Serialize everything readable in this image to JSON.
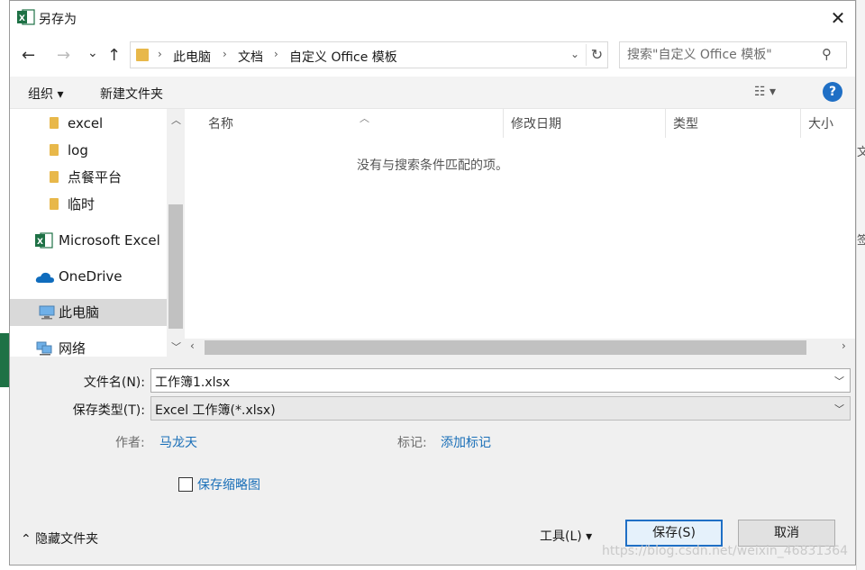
{
  "window": {
    "title": "另存为",
    "close_glyph": "✕"
  },
  "background": {
    "right_text_1": "文",
    "right_text_2": "签"
  },
  "nav": {
    "back_glyph": "←",
    "forward_glyph": "→",
    "recent_glyph": "⌄",
    "up_glyph": "↑",
    "breadcrumbs": [
      "此电脑",
      "文档",
      "自定义 Office 模板"
    ],
    "breadcrumb_sep": "›",
    "refresh_glyph": "↻",
    "dropdown_glyph": "⌄"
  },
  "search": {
    "placeholder": "搜索\"自定义 Office 模板\"",
    "icon": "search-icon"
  },
  "toolbar": {
    "organize_label": "组织 ▾",
    "new_folder_label": "新建文件夹",
    "view_glyph": "☷ ▾",
    "help_glyph": "?"
  },
  "sidebar": {
    "items": [
      {
        "label": "excel",
        "icon": "folder-icon"
      },
      {
        "label": "log",
        "icon": "folder-icon"
      },
      {
        "label": "点餐平台",
        "icon": "folder-icon"
      },
      {
        "label": "临时",
        "icon": "folder-icon"
      },
      {
        "label": "Microsoft Excel",
        "icon": "excel-icon"
      },
      {
        "label": "OneDrive",
        "icon": "cloud-icon"
      },
      {
        "label": "此电脑",
        "icon": "computer-icon",
        "selected": true
      },
      {
        "label": "网络",
        "icon": "network-icon"
      }
    ]
  },
  "file_list": {
    "columns": [
      "名称",
      "修改日期",
      "类型",
      "大小"
    ],
    "empty_message": "没有与搜索条件匹配的项。"
  },
  "form": {
    "filename_label": "文件名(N):",
    "filename_value": "工作簿1.xlsx",
    "filetype_label": "保存类型(T):",
    "filetype_value": "Excel 工作簿(*.xlsx)",
    "author_label": "作者:",
    "author_value": "马龙天",
    "tags_label": "标记:",
    "tags_value": "添加标记",
    "thumbnail_label": "保存缩略图"
  },
  "footer": {
    "hide_folders_label": "⌃ 隐藏文件夹",
    "tools_label": "工具(L)  ▾",
    "save_label": "保存(S)",
    "cancel_label": "取消"
  },
  "watermark": "https://blog.csdn.net/weixin_46831364",
  "colors": {
    "accent": "#1f6fc5",
    "excel_green": "#1e7145",
    "folder": "#e8b84a",
    "link": "#1a6fb8"
  }
}
